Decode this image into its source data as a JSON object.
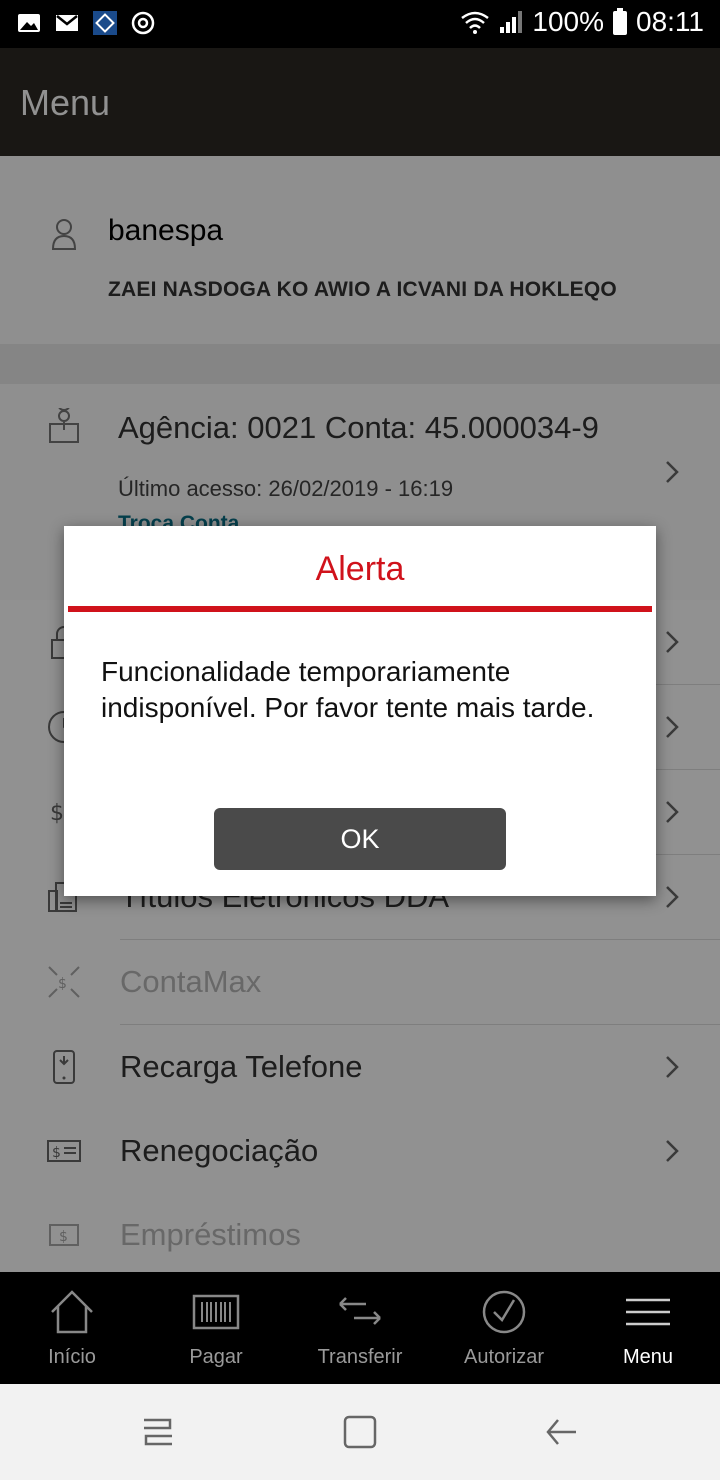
{
  "status_bar": {
    "battery": "100%",
    "time": "08:11",
    "icons": [
      "image-icon",
      "gmail-icon",
      "app-icon",
      "sync-icon",
      "wifi-icon",
      "signal-icon",
      "battery-icon"
    ]
  },
  "header": {
    "title": "Menu"
  },
  "user": {
    "name": "banespa",
    "full_name": "ZAEI NASDOGA KO AWIO A ICVANI DA HOKLEQO"
  },
  "account": {
    "agencia_conta": "Agência: 0021   Conta: 45.000034-9",
    "ultimo_acesso": "Último acesso:   26/02/2019 - 16:19",
    "troca_conta": "Troca Conta"
  },
  "menu": {
    "items": [
      {
        "label": "",
        "icon": "lock-icon"
      },
      {
        "label": "",
        "icon": "clock-icon"
      },
      {
        "label": "",
        "icon": "dollar-icon"
      },
      {
        "label": "Títulos Eletrônicos DDA",
        "icon": "document-icon"
      },
      {
        "label": "ContaMax",
        "icon": "contamax-icon",
        "disabled": true
      },
      {
        "label": "Recarga Telefone",
        "icon": "phone-icon"
      },
      {
        "label": "Renegociação",
        "icon": "bill-icon"
      },
      {
        "label": "Empréstimos",
        "icon": "loan-icon",
        "disabled": true
      }
    ]
  },
  "dialog": {
    "title": "Alerta",
    "message": "Funcionalidade temporariamente indisponível. Por favor tente mais tarde.",
    "ok_label": "OK",
    "accent_color": "#d0121b"
  },
  "tabs": {
    "items": [
      {
        "label": "Início",
        "icon": "home-icon"
      },
      {
        "label": "Pagar",
        "icon": "barcode-icon"
      },
      {
        "label": "Transferir",
        "icon": "transfer-icon"
      },
      {
        "label": "Autorizar",
        "icon": "authorize-icon"
      },
      {
        "label": "Menu",
        "icon": "hamburger-icon",
        "active": true
      }
    ]
  },
  "colors": {
    "header_bg": "#2c2a24",
    "tab_bar_bg": "#000000",
    "link": "#0a6f86"
  }
}
